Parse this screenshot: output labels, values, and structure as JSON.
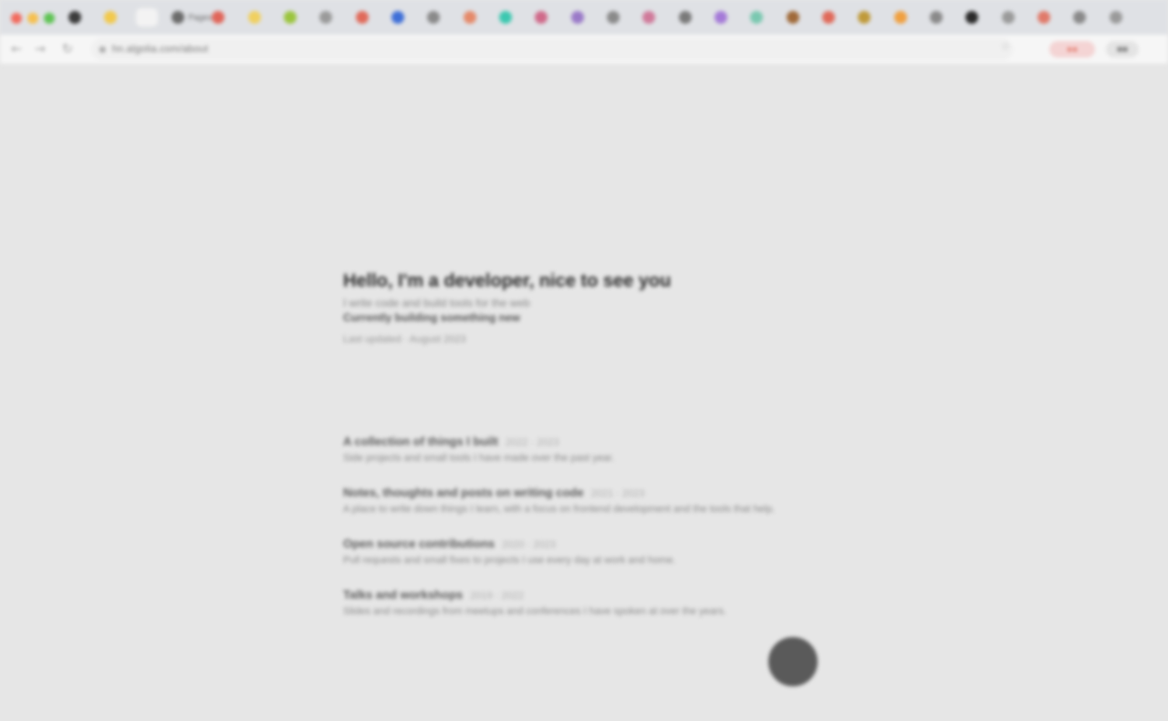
{
  "browser": {
    "tabs": [
      {
        "color": "#3c3c3c",
        "label": ""
      },
      {
        "color": "#f2c94c",
        "label": ""
      },
      {
        "color": "#f3f3f3",
        "label": "",
        "active": true
      },
      {
        "color": "#6b6b6b",
        "label": "Pages"
      },
      {
        "color": "#e0665a",
        "label": ""
      },
      {
        "color": "#f0d060",
        "label": ""
      },
      {
        "color": "#9bc53d",
        "label": ""
      },
      {
        "color": "#9a9a9a",
        "label": ""
      },
      {
        "color": "#e06a5a",
        "label": ""
      },
      {
        "color": "#3f6fd8",
        "label": ""
      },
      {
        "color": "#8a8a8a",
        "label": ""
      },
      {
        "color": "#e58a6a",
        "label": ""
      },
      {
        "color": "#3cc8b0",
        "label": ""
      },
      {
        "color": "#d06a8a",
        "label": ""
      },
      {
        "color": "#9a7ac8",
        "label": ""
      },
      {
        "color": "#8a8a8a",
        "label": ""
      },
      {
        "color": "#d07a9a",
        "label": ""
      },
      {
        "color": "#7a7a7a",
        "label": ""
      },
      {
        "color": "#a57ad8",
        "label": ""
      },
      {
        "color": "#7ac8b0",
        "label": ""
      },
      {
        "color": "#a06a3a",
        "label": ""
      },
      {
        "color": "#e06a5a",
        "label": ""
      },
      {
        "color": "#c09a3a",
        "label": ""
      },
      {
        "color": "#f0a040",
        "label": ""
      },
      {
        "color": "#8a8a8a",
        "label": ""
      },
      {
        "color": "#2a2a2a",
        "label": ""
      },
      {
        "color": "#9a9a9a",
        "label": ""
      },
      {
        "color": "#e07a6a",
        "label": ""
      },
      {
        "color": "#8a8a8a",
        "label": ""
      },
      {
        "color": "#9a9a9a",
        "label": ""
      }
    ],
    "url": "hn.algolia.com/about",
    "traffic_colors": [
      "#f26b5e",
      "#f6c04f",
      "#5fc454"
    ]
  },
  "header": {
    "title": "Hello, I'm a developer, nice to see you",
    "subtitle": "I write code and build tools for the web",
    "emphasis": "Currently building something new",
    "meta": "Last updated · August 2023"
  },
  "entries": [
    {
      "title": "A collection of things I built",
      "date": "2022 · 2023",
      "desc": "Side projects and small tools I have made over the past year."
    },
    {
      "title": "Notes, thoughts and posts on writing code",
      "date": "2021 · 2023",
      "desc": "A place to write down things I learn, with a focus on frontend development and the tools that help."
    },
    {
      "title": "Open source contributions",
      "date": "2020 · 2023",
      "desc": "Pull requests and small fixes to projects I use every day at work and home."
    },
    {
      "title": "Talks and workshops",
      "date": "2019 · 2022",
      "desc": "Slides and recordings from meetups and conferences I have spoken at over the years."
    }
  ]
}
